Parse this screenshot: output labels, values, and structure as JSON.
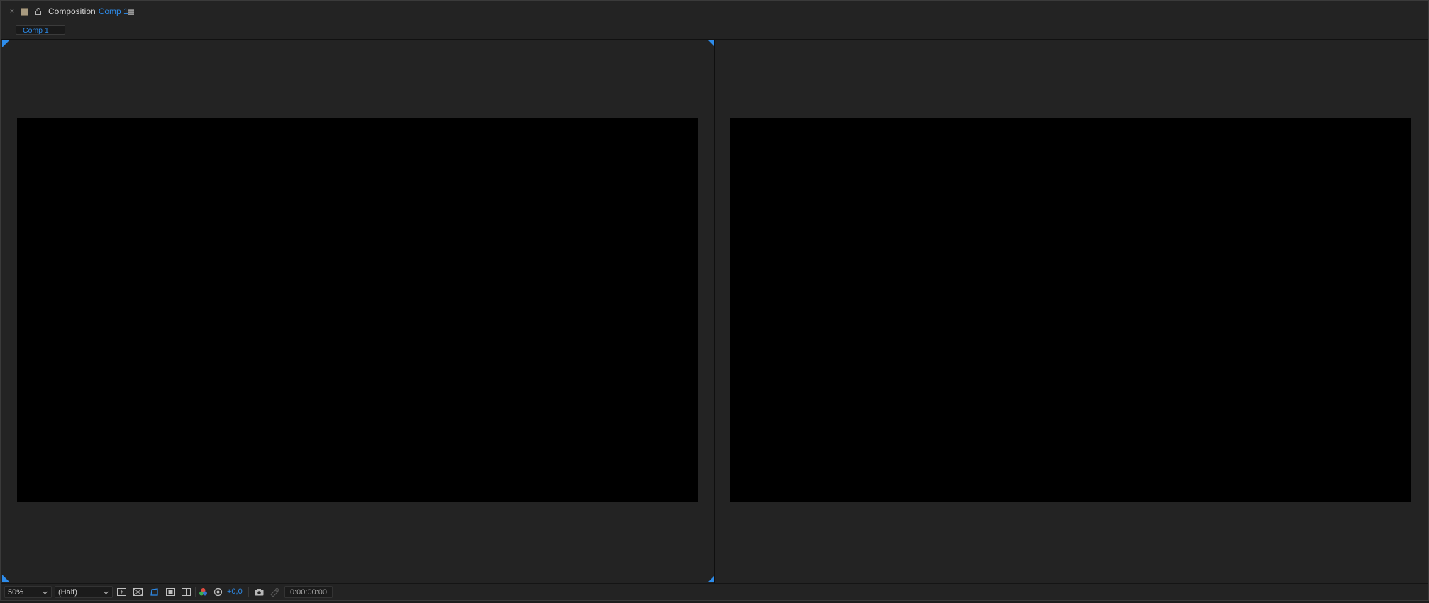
{
  "panel": {
    "title": "Composition",
    "comp_name": "Comp 1",
    "tab_label": "Comp 1",
    "swatch_color": "#a89a7f"
  },
  "toolbar": {
    "zoom": "50%",
    "resolution": "(Half)",
    "exposure": "+0,0",
    "timecode": "0:00:00:00"
  },
  "colors": {
    "accent": "#2d8ceb",
    "panel_bg": "#232323",
    "canvas": "#000000"
  },
  "icons": {
    "close": "close-icon",
    "lock": "lock-icon",
    "menu": "hamburger-menu-icon",
    "fast_previews": "fast-previews-icon",
    "transparency_grid": "transparency-grid-icon",
    "mask_visibility": "mask-visibility-icon",
    "region_of_interest": "region-of-interest-icon",
    "guides": "guides-grid-icon",
    "channels": "rgb-channels-icon",
    "color_management": "color-management-icon",
    "snapshot": "camera-snapshot-icon",
    "show_snapshot": "show-snapshot-icon"
  }
}
